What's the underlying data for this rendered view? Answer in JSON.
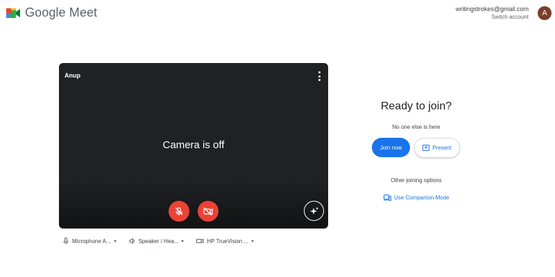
{
  "header": {
    "app_name": "Google Meet",
    "account_email": "writingstrokes@gmail.com",
    "switch_account": "Switch account",
    "avatar_letter": "A"
  },
  "preview": {
    "participant_name": "Anup",
    "camera_status": "Camera is off",
    "controls": {
      "microphone": "muted",
      "camera": "off",
      "effects_icon": "sparkle-icon"
    }
  },
  "devices": [
    {
      "label": "Microphone A...",
      "icon": "microphone-icon"
    },
    {
      "label": "Speaker / Hea...",
      "icon": "speaker-icon"
    },
    {
      "label": "HP TrueVision ...",
      "icon": "camera-icon"
    }
  ],
  "join_panel": {
    "title": "Ready to join?",
    "status": "No one else is here",
    "join_label": "Join now",
    "present_label": "Present",
    "other_options": "Other joining options",
    "companion_mode": "Use Companion Mode"
  },
  "colors": {
    "primary": "#1a73e8",
    "danger": "#ea4335",
    "video_bg": "#202124",
    "avatar_bg": "#7b3f2a"
  }
}
